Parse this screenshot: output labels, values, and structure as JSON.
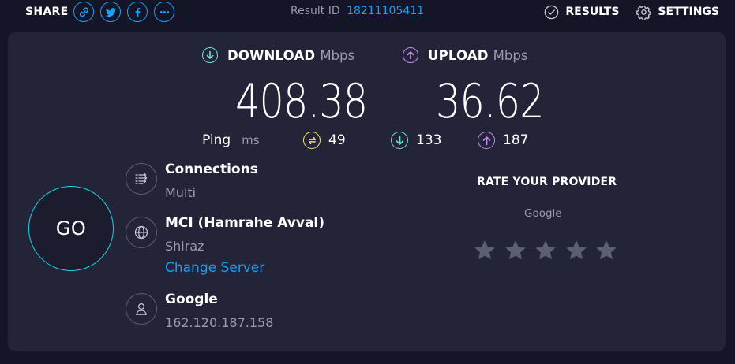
{
  "topbar": {
    "share_label": "SHARE",
    "share_icons": [
      "link-icon",
      "twitter-icon",
      "facebook-icon",
      "more-icon"
    ],
    "result_id_label": "Result ID",
    "result_id_value": "18211105411",
    "results_label": "RESULTS",
    "settings_label": "SETTINGS"
  },
  "speed": {
    "download": {
      "label": "DOWNLOAD",
      "unit": "Mbps",
      "value": "408.38",
      "color": "#6ee0d4"
    },
    "upload": {
      "label": "UPLOAD",
      "unit": "Mbps",
      "value": "36.62",
      "color": "#c58cf0"
    }
  },
  "ping": {
    "label": "Ping",
    "unit": "ms",
    "idle": {
      "value": "49",
      "color": "#f1e569"
    },
    "download": {
      "value": "133",
      "color": "#6ee0d4"
    },
    "upload": {
      "value": "187",
      "color": "#c58cf0"
    }
  },
  "go_label": "GO",
  "connections": {
    "title": "Connections",
    "value": "Multi"
  },
  "server": {
    "name": "MCI (Hamrahe Avval)",
    "city": "Shiraz",
    "change_label": "Change Server"
  },
  "client": {
    "provider": "Google",
    "ip": "162.120.187.158"
  },
  "rate": {
    "title": "RATE YOUR PROVIDER",
    "provider": "Google",
    "stars_total": 5,
    "stars_selected": 0
  },
  "colors": {
    "accent": "#1a9ff5",
    "go_ring": "#1fd1e6",
    "card_bg": "#232437",
    "page_bg": "#141526"
  }
}
